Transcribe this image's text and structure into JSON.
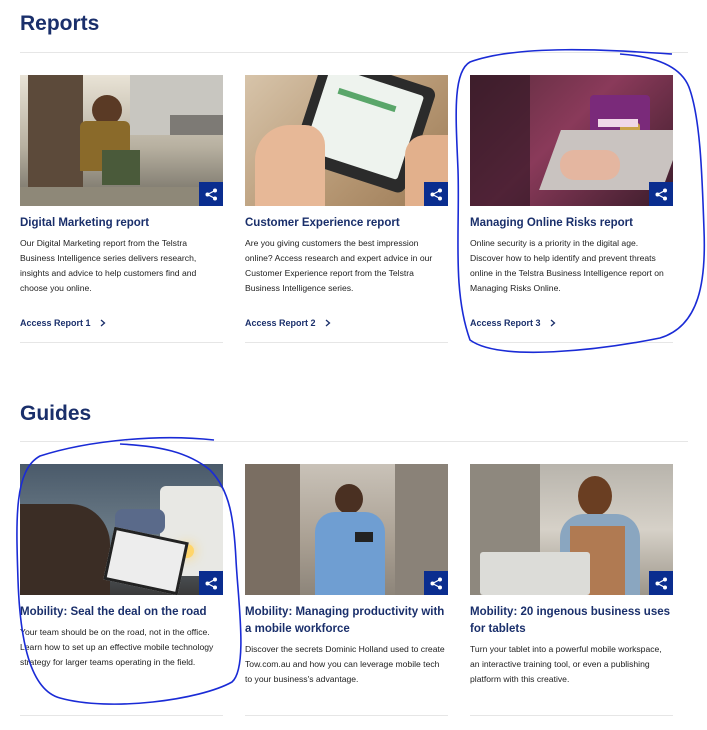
{
  "reports": {
    "heading": "Reports",
    "cards": [
      {
        "title": "Digital Marketing report",
        "description": "Our Digital Marketing report from the Telstra Business Intelligence series delivers research, insights and advice to help customers find and choose you online.",
        "link": "Access Report 1"
      },
      {
        "title": "Customer Experience report",
        "description": "Are you giving customers the best impression online? Access research and expert advice in our Customer Experience report from the Telstra Business Intelligence series.",
        "link": "Access Report 2"
      },
      {
        "title": "Managing Online Risks report",
        "description": "Online security is a priority in the digital age. Discover how to help identify and prevent threats online in the Telstra Business Intelligence report on Managing Risks Online.",
        "link": "Access Report 3"
      }
    ]
  },
  "guides": {
    "heading": "Guides",
    "cards": [
      {
        "title": "Mobility: Seal the deal on the road",
        "description": "Your team should be on the road, not in the office. Learn how to set up an effective mobile technology strategy for larger teams operating in the field."
      },
      {
        "title": "Mobility: Managing productivity with a mobile workforce",
        "description": "Discover the secrets Dominic Holland used to create Tow.com.au and how you can leverage mobile tech to your business's advantage."
      },
      {
        "title": "Mobility: 20 ingenous business uses for tablets",
        "description": "Turn your tablet into a powerful mobile workspace, an interactive training tool, or even a publishing platform with this creative."
      }
    ]
  },
  "colors": {
    "heading": "#1a2f6b",
    "share": "#0a2d8f",
    "annotation": "#1a2bd6"
  },
  "icons": {
    "share": "share-icon",
    "link": "chevron-right-icon"
  }
}
